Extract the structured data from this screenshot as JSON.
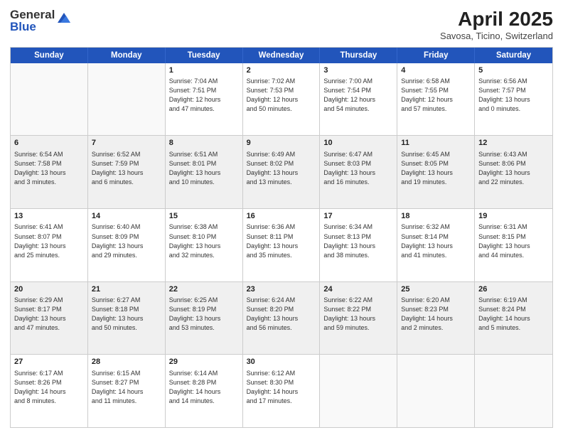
{
  "logo": {
    "general": "General",
    "blue": "Blue"
  },
  "title": {
    "month": "April 2025",
    "location": "Savosa, Ticino, Switzerland"
  },
  "weekdays": [
    "Sunday",
    "Monday",
    "Tuesday",
    "Wednesday",
    "Thursday",
    "Friday",
    "Saturday"
  ],
  "rows": [
    [
      {
        "day": "",
        "lines": []
      },
      {
        "day": "",
        "lines": []
      },
      {
        "day": "1",
        "lines": [
          "Sunrise: 7:04 AM",
          "Sunset: 7:51 PM",
          "Daylight: 12 hours",
          "and 47 minutes."
        ]
      },
      {
        "day": "2",
        "lines": [
          "Sunrise: 7:02 AM",
          "Sunset: 7:53 PM",
          "Daylight: 12 hours",
          "and 50 minutes."
        ]
      },
      {
        "day": "3",
        "lines": [
          "Sunrise: 7:00 AM",
          "Sunset: 7:54 PM",
          "Daylight: 12 hours",
          "and 54 minutes."
        ]
      },
      {
        "day": "4",
        "lines": [
          "Sunrise: 6:58 AM",
          "Sunset: 7:55 PM",
          "Daylight: 12 hours",
          "and 57 minutes."
        ]
      },
      {
        "day": "5",
        "lines": [
          "Sunrise: 6:56 AM",
          "Sunset: 7:57 PM",
          "Daylight: 13 hours",
          "and 0 minutes."
        ]
      }
    ],
    [
      {
        "day": "6",
        "lines": [
          "Sunrise: 6:54 AM",
          "Sunset: 7:58 PM",
          "Daylight: 13 hours",
          "and 3 minutes."
        ]
      },
      {
        "day": "7",
        "lines": [
          "Sunrise: 6:52 AM",
          "Sunset: 7:59 PM",
          "Daylight: 13 hours",
          "and 6 minutes."
        ]
      },
      {
        "day": "8",
        "lines": [
          "Sunrise: 6:51 AM",
          "Sunset: 8:01 PM",
          "Daylight: 13 hours",
          "and 10 minutes."
        ]
      },
      {
        "day": "9",
        "lines": [
          "Sunrise: 6:49 AM",
          "Sunset: 8:02 PM",
          "Daylight: 13 hours",
          "and 13 minutes."
        ]
      },
      {
        "day": "10",
        "lines": [
          "Sunrise: 6:47 AM",
          "Sunset: 8:03 PM",
          "Daylight: 13 hours",
          "and 16 minutes."
        ]
      },
      {
        "day": "11",
        "lines": [
          "Sunrise: 6:45 AM",
          "Sunset: 8:05 PM",
          "Daylight: 13 hours",
          "and 19 minutes."
        ]
      },
      {
        "day": "12",
        "lines": [
          "Sunrise: 6:43 AM",
          "Sunset: 8:06 PM",
          "Daylight: 13 hours",
          "and 22 minutes."
        ]
      }
    ],
    [
      {
        "day": "13",
        "lines": [
          "Sunrise: 6:41 AM",
          "Sunset: 8:07 PM",
          "Daylight: 13 hours",
          "and 25 minutes."
        ]
      },
      {
        "day": "14",
        "lines": [
          "Sunrise: 6:40 AM",
          "Sunset: 8:09 PM",
          "Daylight: 13 hours",
          "and 29 minutes."
        ]
      },
      {
        "day": "15",
        "lines": [
          "Sunrise: 6:38 AM",
          "Sunset: 8:10 PM",
          "Daylight: 13 hours",
          "and 32 minutes."
        ]
      },
      {
        "day": "16",
        "lines": [
          "Sunrise: 6:36 AM",
          "Sunset: 8:11 PM",
          "Daylight: 13 hours",
          "and 35 minutes."
        ]
      },
      {
        "day": "17",
        "lines": [
          "Sunrise: 6:34 AM",
          "Sunset: 8:13 PM",
          "Daylight: 13 hours",
          "and 38 minutes."
        ]
      },
      {
        "day": "18",
        "lines": [
          "Sunrise: 6:32 AM",
          "Sunset: 8:14 PM",
          "Daylight: 13 hours",
          "and 41 minutes."
        ]
      },
      {
        "day": "19",
        "lines": [
          "Sunrise: 6:31 AM",
          "Sunset: 8:15 PM",
          "Daylight: 13 hours",
          "and 44 minutes."
        ]
      }
    ],
    [
      {
        "day": "20",
        "lines": [
          "Sunrise: 6:29 AM",
          "Sunset: 8:17 PM",
          "Daylight: 13 hours",
          "and 47 minutes."
        ]
      },
      {
        "day": "21",
        "lines": [
          "Sunrise: 6:27 AM",
          "Sunset: 8:18 PM",
          "Daylight: 13 hours",
          "and 50 minutes."
        ]
      },
      {
        "day": "22",
        "lines": [
          "Sunrise: 6:25 AM",
          "Sunset: 8:19 PM",
          "Daylight: 13 hours",
          "and 53 minutes."
        ]
      },
      {
        "day": "23",
        "lines": [
          "Sunrise: 6:24 AM",
          "Sunset: 8:20 PM",
          "Daylight: 13 hours",
          "and 56 minutes."
        ]
      },
      {
        "day": "24",
        "lines": [
          "Sunrise: 6:22 AM",
          "Sunset: 8:22 PM",
          "Daylight: 13 hours",
          "and 59 minutes."
        ]
      },
      {
        "day": "25",
        "lines": [
          "Sunrise: 6:20 AM",
          "Sunset: 8:23 PM",
          "Daylight: 14 hours",
          "and 2 minutes."
        ]
      },
      {
        "day": "26",
        "lines": [
          "Sunrise: 6:19 AM",
          "Sunset: 8:24 PM",
          "Daylight: 14 hours",
          "and 5 minutes."
        ]
      }
    ],
    [
      {
        "day": "27",
        "lines": [
          "Sunrise: 6:17 AM",
          "Sunset: 8:26 PM",
          "Daylight: 14 hours",
          "and 8 minutes."
        ]
      },
      {
        "day": "28",
        "lines": [
          "Sunrise: 6:15 AM",
          "Sunset: 8:27 PM",
          "Daylight: 14 hours",
          "and 11 minutes."
        ]
      },
      {
        "day": "29",
        "lines": [
          "Sunrise: 6:14 AM",
          "Sunset: 8:28 PM",
          "Daylight: 14 hours",
          "and 14 minutes."
        ]
      },
      {
        "day": "30",
        "lines": [
          "Sunrise: 6:12 AM",
          "Sunset: 8:30 PM",
          "Daylight: 14 hours",
          "and 17 minutes."
        ]
      },
      {
        "day": "",
        "lines": []
      },
      {
        "day": "",
        "lines": []
      },
      {
        "day": "",
        "lines": []
      }
    ]
  ]
}
